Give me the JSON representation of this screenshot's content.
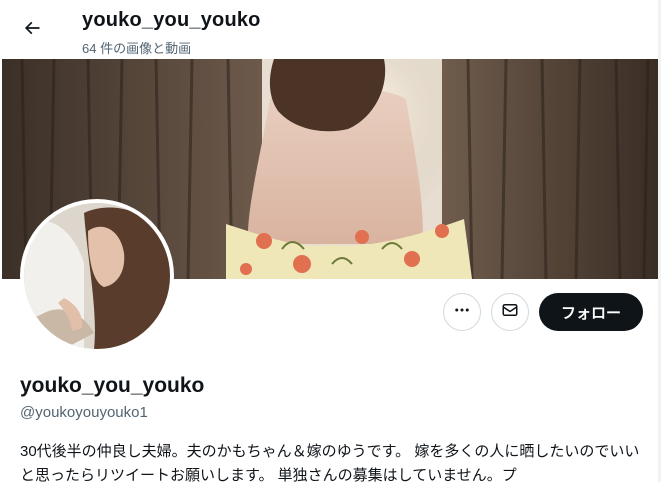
{
  "header": {
    "back_icon": "arrow-left-icon",
    "title": "youko_you_youko",
    "subtitle": "64 件の画像と動画"
  },
  "banner": {
    "description_icon": "banner-photo"
  },
  "actions": {
    "more_icon": "more-horizontal-icon",
    "message_icon": "envelope-icon",
    "follow_label": "フォロー"
  },
  "profile": {
    "display_name": "youko_you_youko",
    "handle": "@youkoyouyouko1",
    "bio": "30代後半の仲良し夫婦。夫のかもちゃん＆嫁のゆうです。 嫁を多くの人に晒したいのでいいと思ったらリツイートお願いします。 単独さんの募集はしていません。プ"
  },
  "colors": {
    "text_primary": "#0f1419",
    "text_secondary": "#536471",
    "follow_bg": "#0f1419",
    "border": "#cfd9de"
  }
}
